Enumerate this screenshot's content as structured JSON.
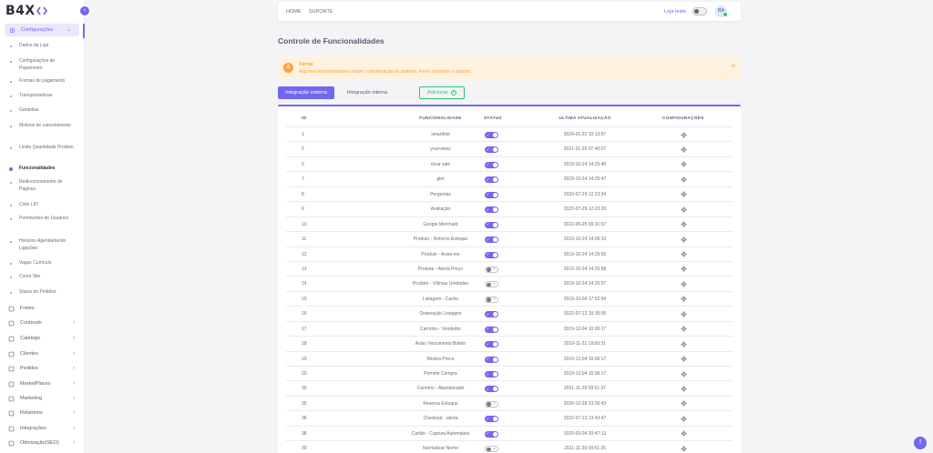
{
  "brand": {
    "logo_text": "B4X",
    "accent": "#7367f0"
  },
  "sidebar": {
    "open_section": "Configurações",
    "sub_items": [
      "Dados da Loja",
      "Configurações de Pagamento",
      "Formas de pagamento",
      "Transportadoras",
      "Garantias",
      "Motivos de cancelamento",
      "Limite Quantidade Produto",
      "Funcionalidades",
      "Redirecionamento de Páginas",
      "Cielo LIO",
      "Permissões de Usuários",
      "Horários Agendamento Ligações",
      "Vagas Currículo",
      "Cores Site",
      "Status do Pedidos"
    ],
    "main_items": [
      {
        "label": "Fretes",
        "icon": "box-icon",
        "chevron": false
      },
      {
        "label": "Conteudo",
        "icon": "layers-icon",
        "chevron": true
      },
      {
        "label": "Catálogo",
        "icon": "grid-icon",
        "chevron": true
      },
      {
        "label": "Clientes",
        "icon": "users-icon",
        "chevron": true
      },
      {
        "label": "Pedidos",
        "icon": "cart-icon",
        "chevron": true
      },
      {
        "label": "MarketPlaces",
        "icon": "store-icon",
        "chevron": true
      },
      {
        "label": "Marketing",
        "icon": "megaphone-icon",
        "chevron": true
      },
      {
        "label": "Relatórios",
        "icon": "chart-icon",
        "chevron": true
      },
      {
        "label": "Integrações",
        "icon": "plug-icon",
        "chevron": true
      },
      {
        "label": "Otimização(SEO)",
        "icon": "seo-icon",
        "chevron": true
      }
    ]
  },
  "topbar": {
    "home": "HOME",
    "suporte": "SUPORTE",
    "store": "Loja teste",
    "avatar": "RA"
  },
  "page": {
    "title": "Controle de Funcionalidades"
  },
  "alert": {
    "title": "Alerta!",
    "message": "Algumas funcionalidades requer customização do sistema. Favor consultar o suporte.",
    "close": "×"
  },
  "tabs": {
    "active": "Integração externa",
    "other": "Integração interna",
    "add": "Adicionar"
  },
  "table": {
    "headers": {
      "id": "ID",
      "func": "FUNCIONALIDADE",
      "status": "STATUS",
      "date": "ULTIMA ATUALIZAÇÃO",
      "conf": "CONFIGURAÇÕES"
    },
    "rows": [
      {
        "id": "1",
        "func": "smarthint",
        "on": true,
        "date": "2024-01-22 10:13:57"
      },
      {
        "id": "5",
        "func": "yourviews",
        "on": true,
        "date": "2021-01-26 07:40:07"
      },
      {
        "id": "6",
        "func": "clear sale",
        "on": true,
        "date": "2019-10-24 14:25:46"
      },
      {
        "id": "7",
        "func": "gtm",
        "on": true,
        "date": "2019-10-24 14:25:47"
      },
      {
        "id": "8",
        "func": "Perguntas",
        "on": true,
        "date": "2023-07-29 12:23:34"
      },
      {
        "id": "9",
        "func": "Avaliação",
        "on": true,
        "date": "2023-07-29 12:23:20"
      },
      {
        "id": "10",
        "func": "Google Merchant",
        "on": true,
        "date": "2022-05-25 09:31:07"
      },
      {
        "id": "11",
        "func": "Produto - Retorno Estoque",
        "on": true,
        "date": "2019-10-24 14:26:10"
      },
      {
        "id": "12",
        "func": "Produto - Avise-me",
        "on": true,
        "date": "2019-10-24 14:25:59"
      },
      {
        "id": "13",
        "func": "Produto - Alerta Preço",
        "on": false,
        "date": "2019-10-24 14:25:58"
      },
      {
        "id": "14",
        "func": "Produto - Ultimas Unidades",
        "on": false,
        "date": "2019-10-24 14:25:57"
      },
      {
        "id": "15",
        "func": "Listagem - Cache",
        "on": false,
        "date": "2019-10-09 17:52:04"
      },
      {
        "id": "16",
        "func": "Ordenação Listagem",
        "on": true,
        "date": "2022-07-12 15:35:06"
      },
      {
        "id": "17",
        "func": "Carrinho - Vendedor",
        "on": true,
        "date": "2019-12-04 16:06:17"
      },
      {
        "id": "18",
        "func": "Aviso Vencimento Boleto",
        "on": true,
        "date": "2019-11-21 19:00:31"
      },
      {
        "id": "19",
        "func": "Mostra Preco",
        "on": true,
        "date": "2019-12-04 16:06:17"
      },
      {
        "id": "20",
        "func": "Permitir Compra",
        "on": true,
        "date": "2019-12-04 16:06:17"
      },
      {
        "id": "30",
        "func": "Carrinho - Abandonado",
        "on": true,
        "date": "2021-11-29 09:51:37"
      },
      {
        "id": "35",
        "func": "Reserva Estoque",
        "on": false,
        "date": "2020-12-28 23:26:43"
      },
      {
        "id": "36",
        "func": "Checkout - alerta",
        "on": true,
        "date": "2022-07-13 13:43:47"
      },
      {
        "id": "38",
        "func": "Cartão - Captura Automatica",
        "on": true,
        "date": "2020-03-04 20:47:13"
      },
      {
        "id": "39",
        "func": "Normalizar Nome",
        "on": false,
        "date": "2021-11-29 09:51:25"
      }
    ]
  },
  "help": "!"
}
